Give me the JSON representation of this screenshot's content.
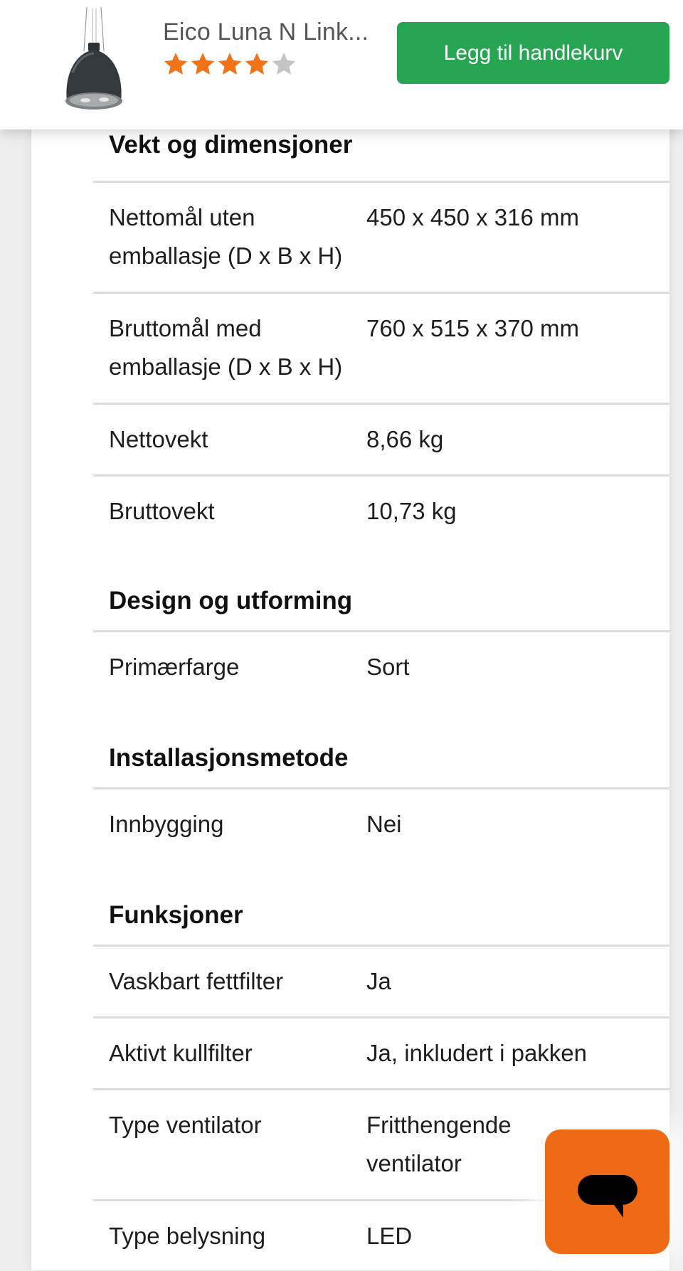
{
  "product": {
    "title": "Eico Luna N Link...",
    "rating": 4,
    "rating_max": 5,
    "image_icon": "pendant-cooker-hood-icon"
  },
  "cart_button": {
    "label": "Legg til handlekurv"
  },
  "colors": {
    "accent_green": "#27a553",
    "star_filled": "#f07317",
    "star_empty": "#c4c4c4",
    "chat_orange": "#ef6a14"
  },
  "sections": [
    {
      "title": "Vekt og dimensjoner",
      "rows": [
        {
          "label": "Nettomål uten emballasje (D x B x H)",
          "value": "450 x 450 x 316 mm"
        },
        {
          "label": "Bruttomål med emballasje (D x B x H)",
          "value": "760 x 515 x 370 mm"
        },
        {
          "label": "Nettovekt",
          "value": "8,66 kg"
        },
        {
          "label": "Bruttovekt",
          "value": "10,73 kg"
        }
      ]
    },
    {
      "title": "Design og utforming",
      "rows": [
        {
          "label": "Primærfarge",
          "value": "Sort"
        }
      ]
    },
    {
      "title": "Installasjonsmetode",
      "rows": [
        {
          "label": "Innbygging",
          "value": "Nei"
        }
      ]
    },
    {
      "title": "Funksjoner",
      "rows": [
        {
          "label": "Vaskbart fettfilter",
          "value": "Ja"
        },
        {
          "label": "Aktivt kullfilter",
          "value": "Ja, inkludert i pakken"
        },
        {
          "label": "Type ventilator",
          "value": "Fritthengende ventilator"
        },
        {
          "label": "Type belysning",
          "value": "LED"
        }
      ]
    }
  ],
  "chat": {
    "icon": "chat-bubble-icon"
  }
}
